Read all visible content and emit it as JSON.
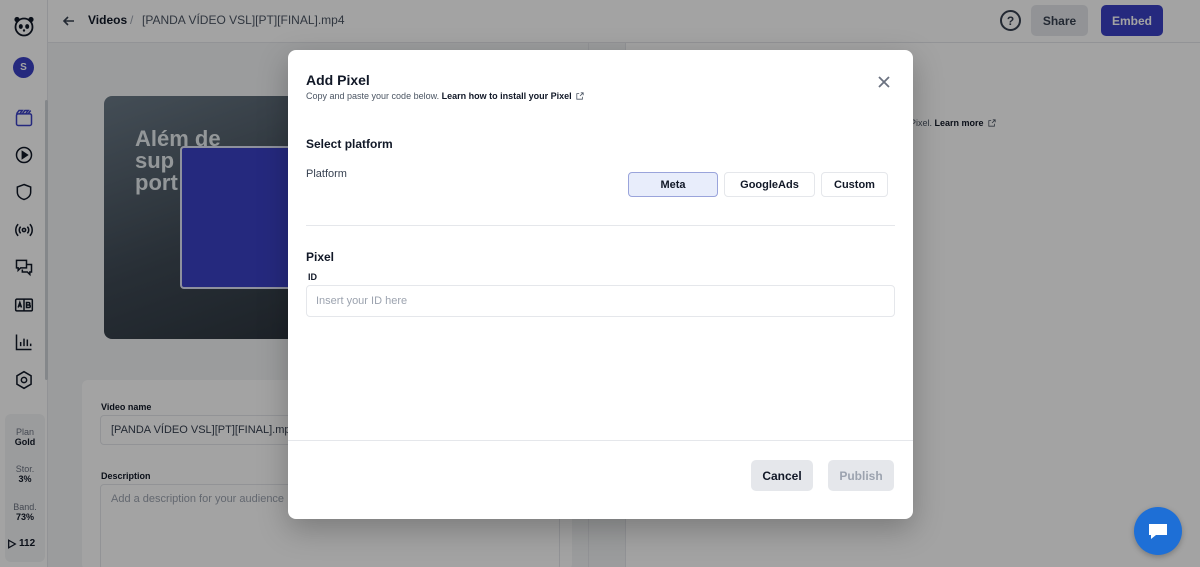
{
  "sidebar": {
    "avatar_initial": "S",
    "icons": [
      "panda-logo-icon",
      "film-icon",
      "play-circle-icon",
      "shield-icon",
      "broadcast-icon",
      "chat-icon",
      "ab-test-icon",
      "chart-icon",
      "settings-icon"
    ],
    "plan_label": "Plan",
    "plan_value": "Gold",
    "storage_label": "Stor.",
    "storage_value": "3%",
    "bandwidth_label": "Band.",
    "bandwidth_value": "73%",
    "plays_value": "112"
  },
  "topbar": {
    "breadcrumb_root": "Videos",
    "breadcrumb_sep": "/",
    "file_name": "[PANDA VÍDEO VSL][PT][FINAL].mp4",
    "help_label": "?",
    "share_label": "Share",
    "embed_label": "Embed",
    "accent_color": "#3b41c5"
  },
  "background": {
    "video_text_lines": [
      "Além de",
      "sup",
      "port"
    ],
    "video_name_label": "Video name",
    "video_name_value": "[PANDA VÍDEO VSL][PT][FINAL].mp",
    "description_label": "Description",
    "description_placeholder": "Add a description for your audience",
    "right_snippet_text": "Pixel.",
    "right_snippet_link": "Learn more"
  },
  "modal": {
    "title": "Add Pixel",
    "subtitle": "Copy and paste your code below.",
    "subtitle_link": "Learn how to install your Pixel",
    "section_platform": "Select platform",
    "platform_label": "Platform",
    "platforms": [
      "Meta",
      "GoogleAds",
      "Custom"
    ],
    "selected_platform": "Meta",
    "section_pixel": "Pixel",
    "id_label": "ID",
    "id_placeholder": "Insert your ID here",
    "cancel_label": "Cancel",
    "publish_label": "Publish"
  },
  "chat": {
    "color": "#1e6fd6"
  }
}
